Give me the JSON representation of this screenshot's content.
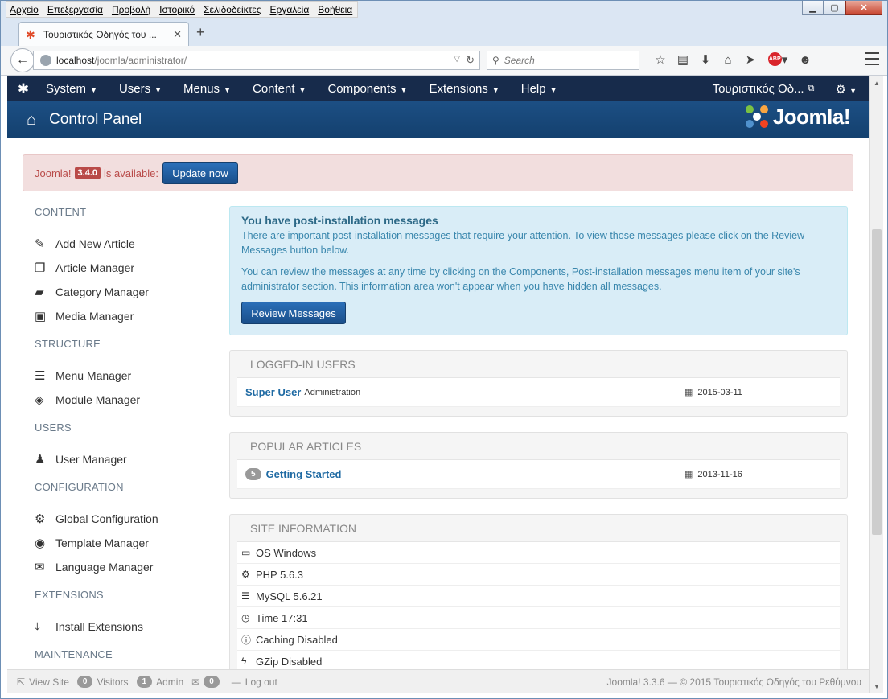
{
  "os_menu": [
    "Αρχείο",
    "Επεξεργασία",
    "Προβολή",
    "Ιστορικό",
    "Σελιδοδείκτες",
    "Εργαλεία",
    "Βοήθεια"
  ],
  "browser": {
    "tab_title": "Τουριστικός Οδηγός του ...",
    "url_host": "localhost",
    "url_path": "/joomla/administrator/",
    "search_placeholder": "Search"
  },
  "joomla_nav": {
    "items": [
      "System",
      "Users",
      "Menus",
      "Content",
      "Components",
      "Extensions",
      "Help"
    ],
    "site_name": "Τουριστικός Οδ..."
  },
  "header": {
    "title": "Control Panel",
    "brand": "Joomla!"
  },
  "update_alert": {
    "prefix": "Joomla!",
    "version": "3.4.0",
    "suffix": "is available:",
    "button": "Update now"
  },
  "sidebar": {
    "groups": [
      {
        "title": "CONTENT",
        "items": [
          {
            "label": "Add New Article",
            "icon": "pencil-icon"
          },
          {
            "label": "Article Manager",
            "icon": "copy-icon"
          },
          {
            "label": "Category Manager",
            "icon": "folder-icon"
          },
          {
            "label": "Media Manager",
            "icon": "image-icon"
          }
        ]
      },
      {
        "title": "STRUCTURE",
        "items": [
          {
            "label": "Menu Manager",
            "icon": "list-icon"
          },
          {
            "label": "Module Manager",
            "icon": "cube-icon"
          }
        ]
      },
      {
        "title": "USERS",
        "items": [
          {
            "label": "User Manager",
            "icon": "user-icon"
          }
        ]
      },
      {
        "title": "CONFIGURATION",
        "items": [
          {
            "label": "Global Configuration",
            "icon": "gear-icon"
          },
          {
            "label": "Template Manager",
            "icon": "eye-icon"
          },
          {
            "label": "Language Manager",
            "icon": "comments-icon"
          }
        ]
      },
      {
        "title": "EXTENSIONS",
        "items": [
          {
            "label": "Install Extensions",
            "icon": "download-icon"
          }
        ]
      },
      {
        "title": "MAINTENANCE",
        "items": []
      }
    ]
  },
  "post_install": {
    "title": "You have post-installation messages",
    "p1": "There are important post-installation messages that require your attention. To view those messages please click on the Review Messages button below.",
    "p2": "You can review the messages at any time by clicking on the Components, Post-installation messages menu item of your site's administrator section. This information area won't appear when you have hidden all messages.",
    "button": "Review Messages"
  },
  "logged_in": {
    "title": "LOGGED-IN USERS",
    "rows": [
      {
        "name": "Super User",
        "role": "Administration",
        "date": "2015-03-11"
      }
    ]
  },
  "popular": {
    "title": "POPULAR ARTICLES",
    "rows": [
      {
        "hits": "5",
        "name": "Getting Started",
        "date": "2013-11-16"
      }
    ]
  },
  "site_info": {
    "title": "SITE INFORMATION",
    "rows": [
      {
        "label": "OS Windows",
        "icon": "monitor-icon"
      },
      {
        "label": "PHP 5.6.3",
        "icon": "cogs-icon"
      },
      {
        "label": "MySQL 5.6.21",
        "icon": "database-icon"
      },
      {
        "label": "Time 17:31",
        "icon": "clock-icon"
      },
      {
        "label": "Caching Disabled",
        "icon": "info-icon"
      },
      {
        "label": "GZip Disabled",
        "icon": "lightning-icon"
      }
    ]
  },
  "status_bar": {
    "view_site": "View Site",
    "visitors_count": "0",
    "visitors": "Visitors",
    "admin_count": "1",
    "admin": "Admin",
    "messages_count": "0",
    "logout": "Log out",
    "copyright": "Joomla! 3.3.6 — © 2015 Τουριστικός Οδηγός του Ρεθύμνου"
  }
}
